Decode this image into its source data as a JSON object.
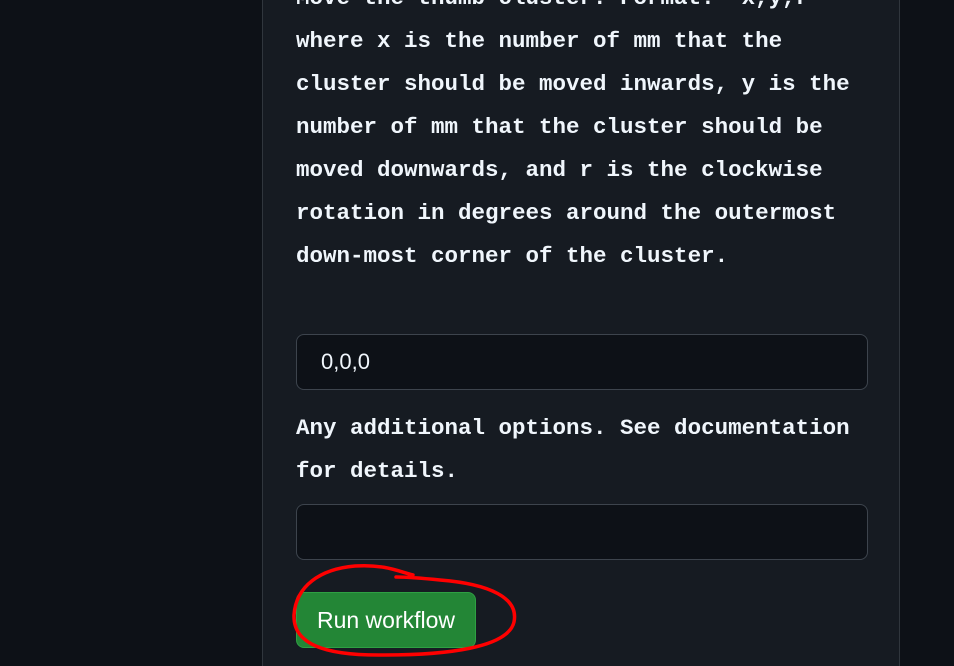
{
  "form": {
    "thumb_cluster": {
      "label": "Move the thumb cluster. Format: `x,y,r` where x is the number of mm that the cluster should be moved inwards, y is the number of mm that the cluster should be moved downwards, and r is the clockwise rotation in degrees around the outermost down-most corner of the cluster.",
      "value": "0,0,0"
    },
    "additional_options": {
      "label": "Any additional options. See documentation for details.",
      "value": ""
    },
    "run_button_label": "Run workflow"
  },
  "colors": {
    "background": "#0d1117",
    "panel": "#161b22",
    "button": "#238636",
    "annotation": "#ff0000"
  }
}
